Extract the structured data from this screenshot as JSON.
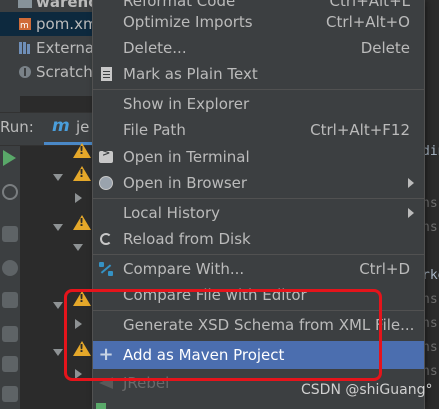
{
  "project_tree": {
    "items": [
      {
        "label": "wareho",
        "icon": "folder-icon"
      },
      {
        "label": "pom.xm",
        "icon": "maven-file-icon"
      },
      {
        "label": "Externa",
        "icon": "external-libraries-icon"
      },
      {
        "label": "Scratch",
        "icon": "scratches-icon"
      }
    ]
  },
  "run_panel": {
    "label": "Run:",
    "tab_icon": "m",
    "tab_label": "je"
  },
  "right_fragments": [
    "din",
    "ns",
    "ns",
    "rke",
    "ns",
    "ns",
    "ns",
    "ns",
    "ns",
    "ns"
  ],
  "context_menu": {
    "items": [
      {
        "label": "Reformat Code",
        "shortcut": "Ctrl+Alt+L"
      },
      {
        "label": "Optimize Imports",
        "shortcut": "Ctrl+Alt+O"
      },
      {
        "label": "Delete...",
        "shortcut": "Delete"
      },
      {
        "label": "Mark as Plain Text",
        "icon": "plain-text-icon"
      },
      {
        "label": "Show in Explorer"
      },
      {
        "label": "File Path",
        "shortcut": "Ctrl+Alt+F12"
      },
      {
        "label": "Open in Terminal",
        "icon": "terminal-icon"
      },
      {
        "label": "Open in Browser",
        "icon": "globe-icon"
      },
      {
        "label": "Local History"
      },
      {
        "label": "Reload from Disk",
        "icon": "reload-icon"
      },
      {
        "label": "Compare With...",
        "shortcut": "Ctrl+D",
        "icon": "compare-icon"
      },
      {
        "label": "Compare File with Editor"
      },
      {
        "label": "Generate XSD Schema from XML File..."
      },
      {
        "label": "Add as Maven Project",
        "icon": "plus-icon"
      },
      {
        "label": "JRebel",
        "icon": "jrebel-icon"
      }
    ]
  },
  "colors": {
    "menu_bg": "#3c3f41",
    "highlight": "#4b6eaf",
    "annotation": "#e5141b",
    "warning": "#e5a82a"
  },
  "watermark": "CSDN @shiGuang°"
}
